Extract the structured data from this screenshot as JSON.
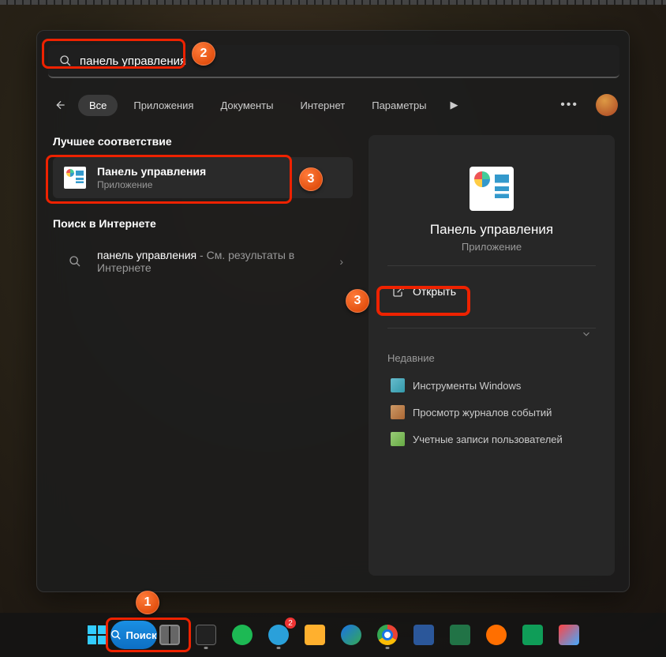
{
  "search": {
    "value": "панель управления"
  },
  "tabs": {
    "all": "Все",
    "apps": "Приложения",
    "docs": "Документы",
    "web": "Интернет",
    "settings": "Параметры"
  },
  "sections": {
    "best_match": "Лучшее соответствие",
    "web_search": "Поиск в Интернете",
    "recent": "Недавние"
  },
  "result": {
    "title": "Панель управления",
    "subtitle": "Приложение"
  },
  "web_result": {
    "prefix": "панель управления",
    "suffix": " - См. результаты в Интернете"
  },
  "detail": {
    "title": "Панель управления",
    "subtitle": "Приложение",
    "open": "Открыть"
  },
  "recent_items": [
    "Инструменты Windows",
    "Просмотр журналов событий",
    "Учетные записи пользователей"
  ],
  "taskbar": {
    "search": "Поиск",
    "telegram_badge": "2"
  },
  "annotations": {
    "a1": "1",
    "a2": "2",
    "a3": "3",
    "a3b": "3"
  }
}
